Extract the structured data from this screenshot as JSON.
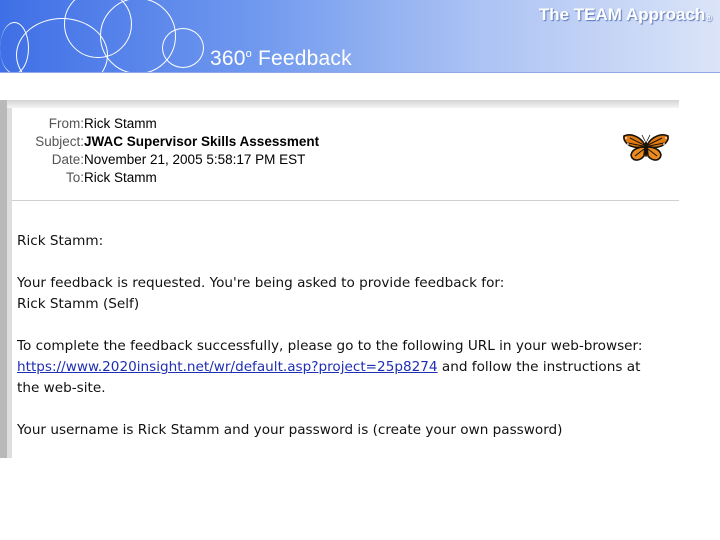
{
  "banner": {
    "brand": "The TEAM Approach",
    "brand_mark": "®",
    "title": "360",
    "title_degree": "o",
    "title_rest": " Feedback"
  },
  "email": {
    "headers": [
      {
        "label": "From:",
        "value": "Rick Stamm"
      },
      {
        "label": "Subject:",
        "value": "JWAC Supervisor Skills Assessment"
      },
      {
        "label": "Date:",
        "value": "November 21, 2005 5:58:17 PM EST"
      },
      {
        "label": "To:",
        "value": "Rick Stamm"
      }
    ],
    "body": {
      "greeting": "Rick Stamm:",
      "request_line1": "Your feedback is requested.  You're being asked to provide feedback for:",
      "request_line2": "Rick Stamm (Self)",
      "instruction_line1": "To complete the feedback successfully, please go to the following URL in your web-browser:",
      "url": "https://www.2020insight.net/wr/default.asp?project=25p8274",
      "instruction_after_url": " and follow the instructions at",
      "instruction_line3": "the web-site.",
      "credentials": "Your username is Rick Stamm and your password is (create your own password)"
    }
  }
}
